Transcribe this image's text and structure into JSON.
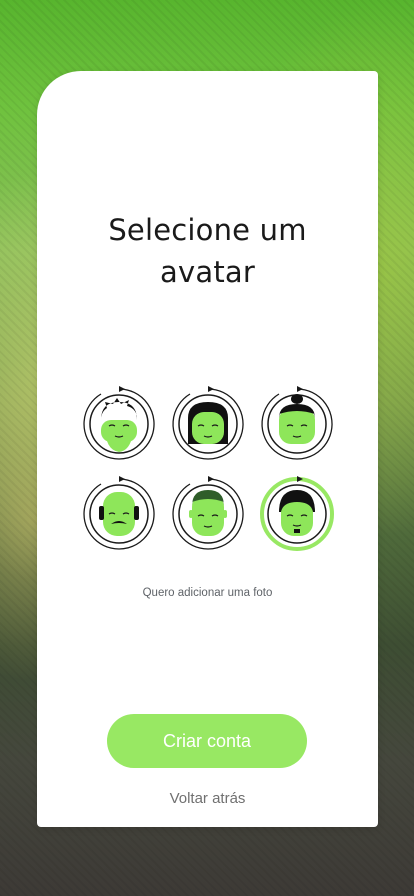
{
  "screen": {
    "title": "Selecione um\navatar",
    "add_photo_link": "Quero adicionar uma foto",
    "create_account_button": "Criar conta",
    "back_link": "Voltar atrás"
  },
  "avatars": [
    {
      "icon": "avatar-icon-spiky-hair",
      "selected": false
    },
    {
      "icon": "avatar-icon-long-hair",
      "selected": false
    },
    {
      "icon": "avatar-icon-bun-hair",
      "selected": false
    },
    {
      "icon": "avatar-icon-balding-mustache",
      "selected": false
    },
    {
      "icon": "avatar-icon-short-hair",
      "selected": false
    },
    {
      "icon": "avatar-icon-bowl-cut-goatee",
      "selected": true
    }
  ],
  "colors": {
    "accent": "#98e863",
    "face": "#8ee65a",
    "ring": "#1a1a1a"
  }
}
